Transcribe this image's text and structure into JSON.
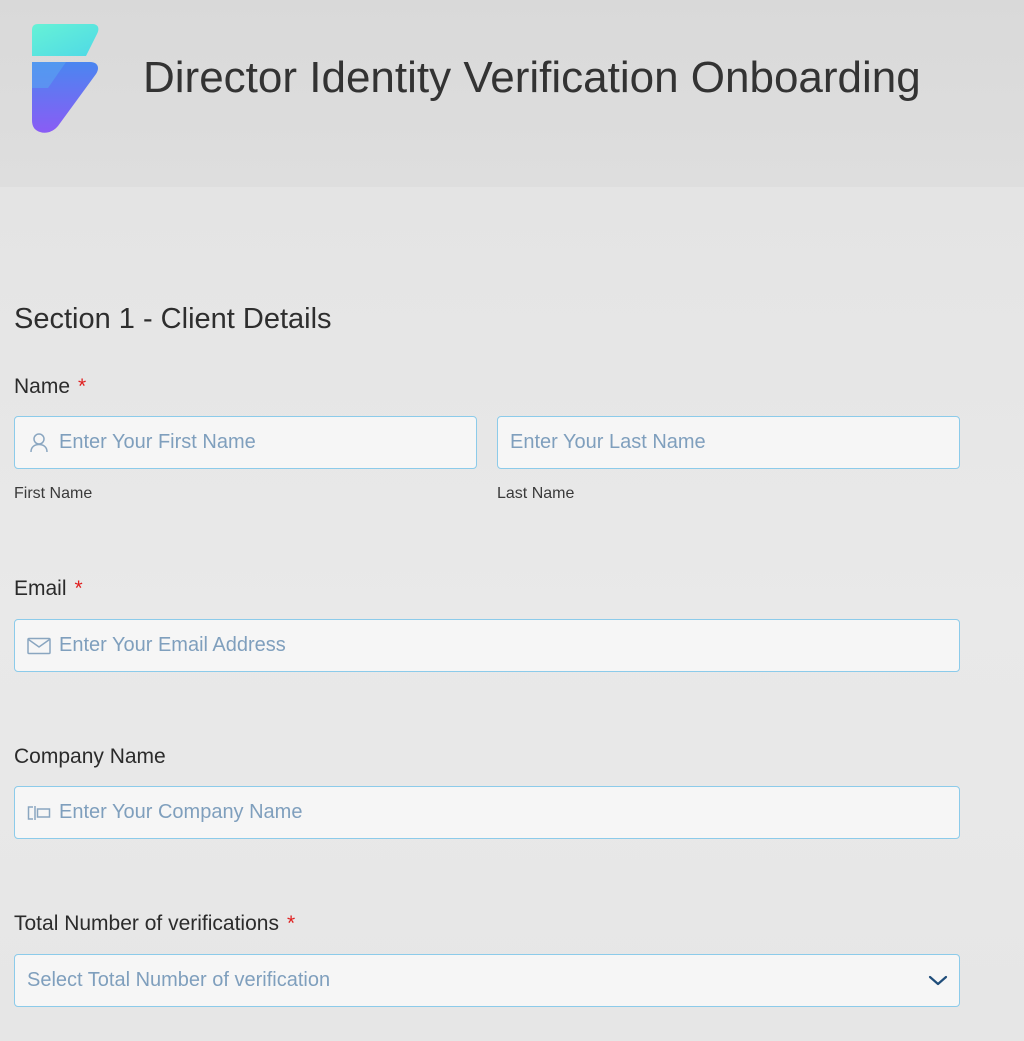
{
  "header": {
    "title": "Director Identity Verification Onboarding",
    "logo_colors": [
      "#5ef0d8",
      "#7d5cf5"
    ]
  },
  "section": {
    "title": "Section 1 - Client Details"
  },
  "name": {
    "label": "Name",
    "required_mark": "*",
    "first": {
      "placeholder": "Enter Your First Name",
      "sublabel": "First Name",
      "icon": "user-icon"
    },
    "last": {
      "placeholder": "Enter Your Last Name",
      "sublabel": "Last Name"
    }
  },
  "email": {
    "label": "Email",
    "required_mark": "*",
    "placeholder": "Enter Your Email Address",
    "icon": "envelope-icon"
  },
  "company": {
    "label": "Company Name",
    "placeholder": "Enter Your Company Name",
    "icon": "company-icon"
  },
  "verifications": {
    "label": "Total Number of verifications",
    "required_mark": "*",
    "placeholder": "Select Total Number of verification",
    "icon": "chevron-down-icon"
  },
  "colors": {
    "accent_border": "#8ccbea",
    "placeholder_text": "#7f9fbd",
    "required": "#e02020",
    "chevron": "#1f4d7a"
  }
}
